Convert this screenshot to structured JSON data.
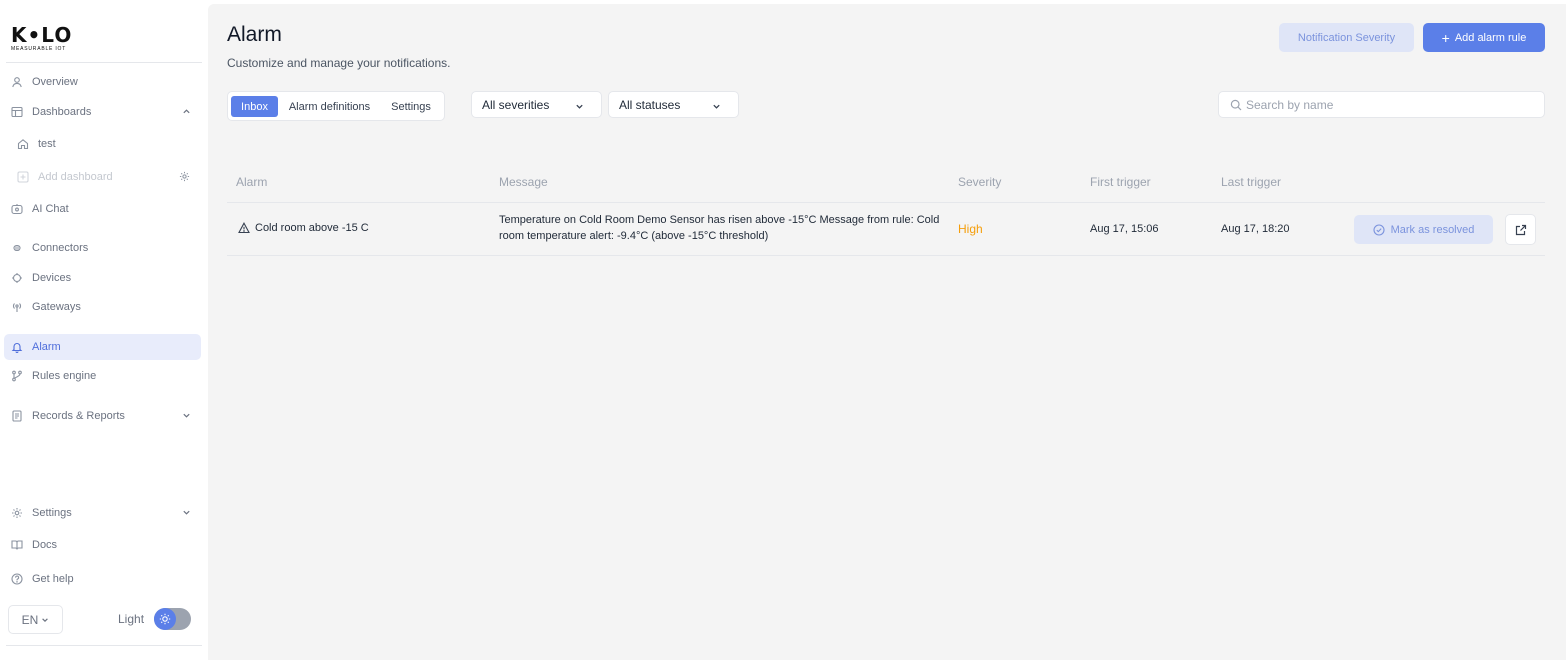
{
  "brand": {
    "name": "K•LO",
    "tagline": "MEASURABLE IOT"
  },
  "sidebar": {
    "items": [
      {
        "label": "Overview",
        "icon": "user-icon"
      },
      {
        "label": "Dashboards",
        "icon": "layout-icon"
      },
      {
        "label": "test",
        "icon": "home-icon"
      },
      {
        "label": "Add dashboard",
        "icon": "plus-square-icon"
      },
      {
        "label": "AI Chat",
        "icon": "bot-icon"
      },
      {
        "label": "Connectors",
        "icon": "plug-icon"
      },
      {
        "label": "Devices",
        "icon": "chip-icon"
      },
      {
        "label": "Gateways",
        "icon": "antenna-icon"
      },
      {
        "label": "Alarm",
        "icon": "bell-icon"
      },
      {
        "label": "Rules engine",
        "icon": "branch-icon"
      },
      {
        "label": "Records & Reports",
        "icon": "document-icon"
      },
      {
        "label": "Settings",
        "icon": "gear-icon"
      },
      {
        "label": "Docs",
        "icon": "book-icon"
      },
      {
        "label": "Get help",
        "icon": "help-icon"
      }
    ],
    "language": "EN",
    "theme_label": "Light"
  },
  "header": {
    "title": "Alarm",
    "subtitle": "Customize and manage your notifications.",
    "severity_button": "Notification Severity",
    "add_button": "Add alarm rule"
  },
  "tabs": [
    {
      "label": "Inbox",
      "active": true
    },
    {
      "label": "Alarm definitions",
      "active": false
    },
    {
      "label": "Settings",
      "active": false
    }
  ],
  "filters": {
    "severity": "All severities",
    "status": "All statuses",
    "search_placeholder": "Search by name"
  },
  "table": {
    "columns": [
      "Alarm",
      "Message",
      "Severity",
      "First trigger",
      "Last trigger"
    ],
    "rows": [
      {
        "alarm": "Cold room above -15 C",
        "message": "Temperature on Cold Room Demo Sensor has risen above -15°C Message from rule: Cold room temperature alert: -9.4°C (above -15°C threshold)",
        "severity": "High",
        "first_trigger": "Aug 17, 15:06",
        "last_trigger": "Aug 17, 18:20",
        "action": "Mark as resolved"
      }
    ]
  },
  "colors": {
    "accent": "#5b7fe8",
    "accent_soft": "#dfe5f7",
    "severity_high": "#f59e0b",
    "main_bg": "#f4f4f4"
  }
}
